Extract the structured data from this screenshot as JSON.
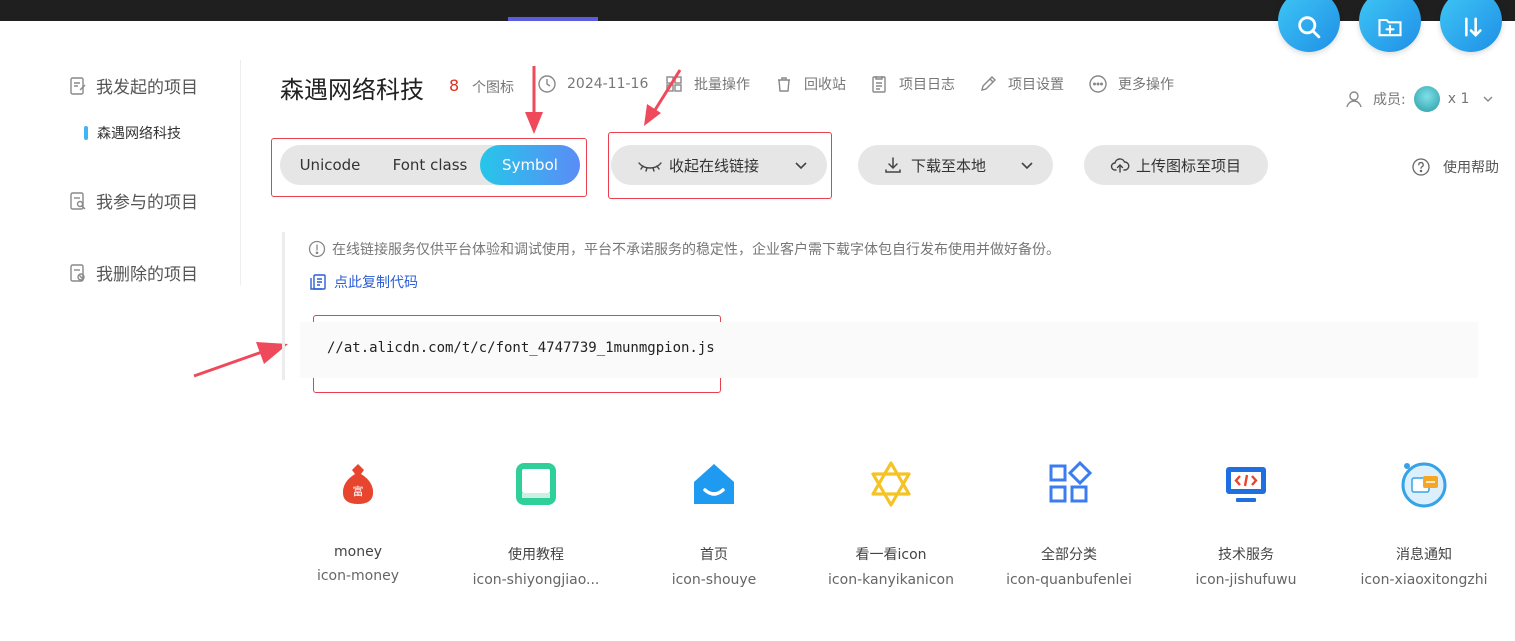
{
  "sidebar": {
    "initiated_label": "我发起的项目",
    "active_project": "森遇网络科技",
    "participated_label": "我参与的项目",
    "deleted_label": "我删除的项目"
  },
  "header": {
    "project_title": "森遇网络科技",
    "icon_count": "8",
    "icon_count_label": "个图标",
    "date": "2024-11-16",
    "batch_label": "批量操作",
    "recycle_label": "回收站",
    "log_label": "项目日志",
    "settings_label": "项目设置",
    "more_label": "更多操作",
    "members_label": "成员:",
    "members_count": "x 1"
  },
  "format_tabs": [
    "Unicode",
    "Font class",
    "Symbol"
  ],
  "active_tab": "Symbol",
  "toolbar": {
    "collapse_link_label": "收起在线链接",
    "download_label": "下载至本地",
    "upload_label": "上传图标至项目",
    "help_label": "使用帮助"
  },
  "notice": {
    "text": "在线链接服务仅供平台体验和调试使用，平台不承诺服务的稳定性，企业客户需下载字体包自行发布使用并做好备份。",
    "copy_label": "点此复制代码",
    "code": "//at.alicdn.com/t/c/font_4747739_1munmgpion.js"
  },
  "icons": [
    {
      "name": "money",
      "code": "icon-money",
      "icon": "money-bag-icon",
      "color": "#e8452f"
    },
    {
      "name": "使用教程",
      "code": "icon-shiyongjiao...",
      "icon": "book-icon",
      "color": "#2fcf9a"
    },
    {
      "name": "首页",
      "code": "icon-shouye",
      "icon": "home-icon",
      "color": "#1e9bf0"
    },
    {
      "name": "看一看icon",
      "code": "icon-kanyikanicon",
      "icon": "star-of-david-icon",
      "color": "#f6c325"
    },
    {
      "name": "全部分类",
      "code": "icon-quanbufenlei",
      "icon": "category-grid-icon",
      "color": "#3b7cf0"
    },
    {
      "name": "技术服务",
      "code": "icon-jishufuwu",
      "icon": "code-monitor-icon",
      "color": "#1f6fe0"
    },
    {
      "name": "消息通知",
      "code": "icon-xiaoxitongzhi",
      "icon": "message-notify-icon",
      "color": "#36a3e8"
    }
  ],
  "colors": {
    "accent_gradient_start": "#26c6e9",
    "accent_gradient_end": "#5b8cf6",
    "annotation_red": "#e8404f",
    "count_red": "#e0301e",
    "link_blue": "#2b5ed6"
  }
}
